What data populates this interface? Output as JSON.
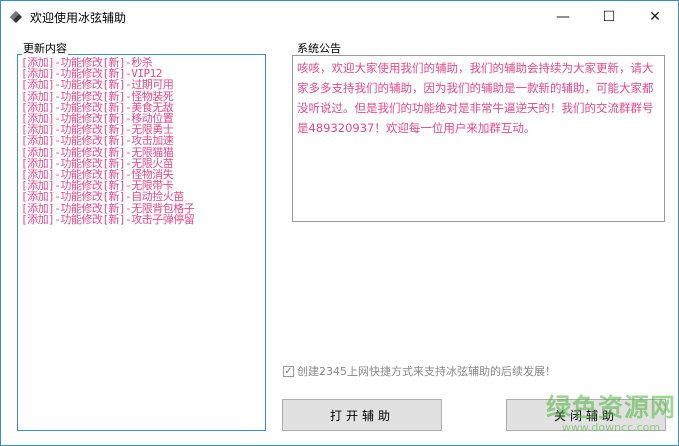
{
  "window": {
    "title": "欢迎使用冰弦辅助",
    "controls": {
      "minimize": "—",
      "maximize": "☐",
      "close": "✕"
    }
  },
  "update_panel": {
    "label": "更新内容",
    "items": [
      "[添加]-功能修改[新]-秒杀",
      "[添加]-功能修改[新]-VIP12",
      "[添加]-功能修改[新]-过期可用",
      "[添加]-功能修改[新]-怪物装死",
      "[添加]-功能修改[新]-美食无敌",
      "[添加]-功能修改[新]-移动位置",
      "[添加]-功能修改[新]-无限勇士",
      "[添加]-功能修改[新]-攻击加速",
      "[添加]-功能修改[新]-无限猫猫",
      "[添加]-功能修改[新]-无限火苗",
      "[添加]-功能修改[新]-怪物消失",
      "[添加]-功能修改[新]-无限带卡",
      "[添加]-功能修改[新]-自动捡火苗",
      "[添加]-功能修改[新]-无限背包格子",
      "[添加]-功能修改[新]-攻击子弹停留"
    ]
  },
  "notice_panel": {
    "label": "系统公告",
    "text": "咳咳，欢迎大家使用我们的辅助，我们的辅助会持续为大家更新，请大家多多支持我们的辅助，因为我们的辅助是一款新的辅助，可能大家都没听说过。但是我们的功能绝对是非常牛逼逆天的！我们的交流群群号是489320937！欢迎每一位用户来加群互动。"
  },
  "checkbox": {
    "label": "创建2345上网快捷方式来支持冰弦辅助的后续发展！",
    "checked": true
  },
  "buttons": {
    "open": "打开辅助",
    "close": "关闭辅助"
  },
  "watermark": {
    "name": "绿色资源网",
    "url": "www.downcc.com"
  }
}
